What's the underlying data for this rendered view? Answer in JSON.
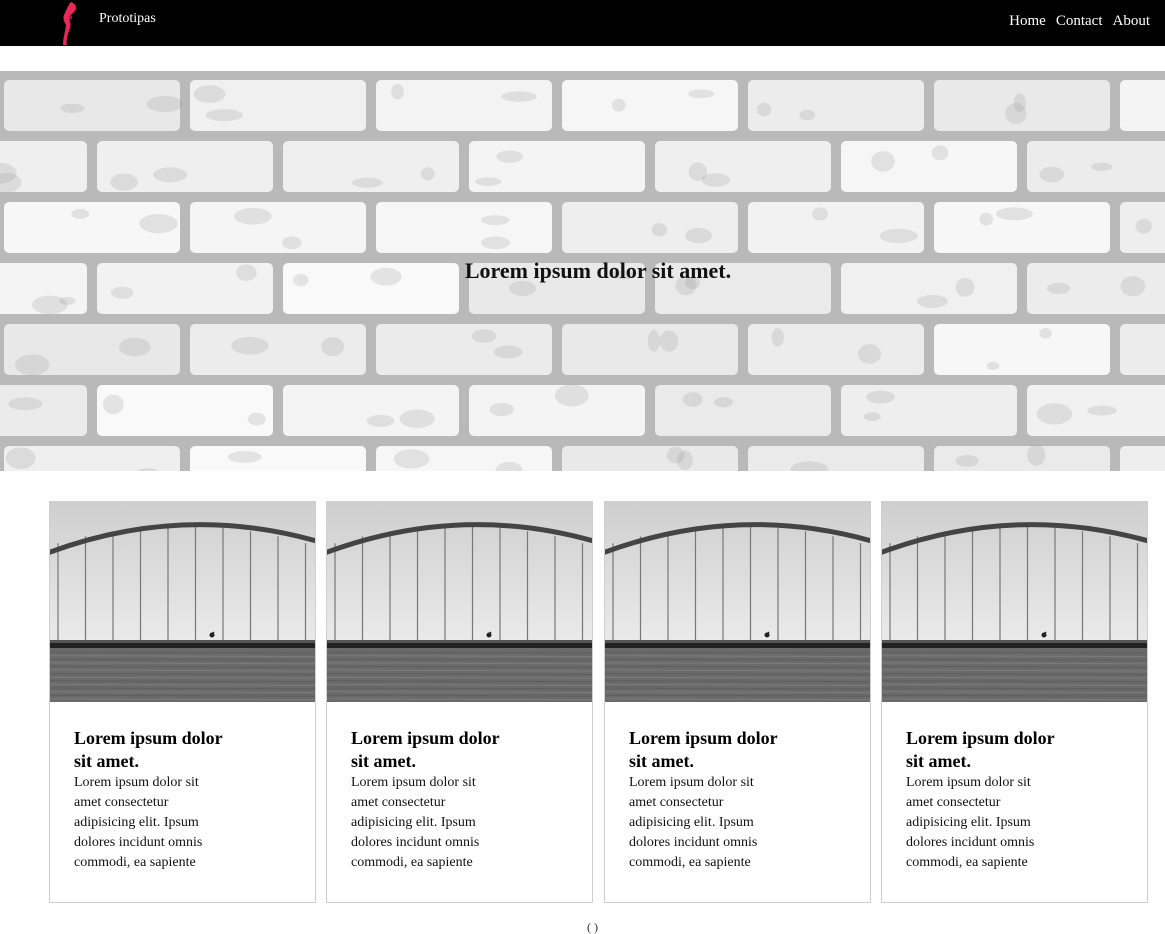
{
  "header": {
    "brand": "Prototipas",
    "nav": [
      "Home",
      "Contact",
      "About"
    ],
    "accent_color": "#e8275a"
  },
  "hero": {
    "title": "Lorem ipsum dolor sit amet."
  },
  "cards": [
    {
      "title": "Lorem ipsum dolor sit amet.",
      "text": "Lorem ipsum dolor sit amet consectetur adipisicing elit. Ipsum dolores incidunt omnis commodi, ea sapiente"
    },
    {
      "title": "Lorem ipsum dolor sit amet.",
      "text": "Lorem ipsum dolor sit amet consectetur adipisicing elit. Ipsum dolores incidunt omnis commodi, ea sapiente"
    },
    {
      "title": "Lorem ipsum dolor sit amet.",
      "text": "Lorem ipsum dolor sit amet consectetur adipisicing elit. Ipsum dolores incidunt omnis commodi, ea sapiente"
    },
    {
      "title": "Lorem ipsum dolor sit amet.",
      "text": "Lorem ipsum dolor sit amet consectetur adipisicing elit. Ipsum dolores incidunt omnis commodi, ea sapiente"
    }
  ],
  "footer": {
    "pager_text": "( )"
  }
}
